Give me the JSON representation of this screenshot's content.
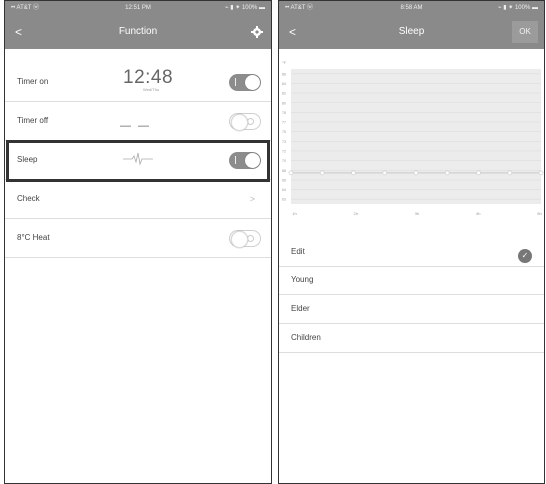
{
  "left_screen": {
    "statusbar": {
      "carrier": "•• AT&T ⓦ",
      "time": "12:51 PM",
      "battery": "⌁ ▮ ⁕ 100% ▬"
    },
    "navbar": {
      "back": "<",
      "title": "Function",
      "icon": "gear-icon"
    },
    "rows": [
      {
        "label": "Timer on",
        "time": "12:48",
        "date": "Wed/Thu",
        "toggle": "on"
      },
      {
        "label": "Timer off",
        "time": "— —",
        "toggle": "off"
      },
      {
        "label": "Sleep",
        "icon": "sleep-wave-icon",
        "toggle": "on",
        "selected": true
      },
      {
        "label": "Check",
        "chevron": ">"
      },
      {
        "label": "8°C Heat",
        "toggle": "off"
      }
    ]
  },
  "right_screen": {
    "statusbar": {
      "carrier": "•• AT&T ⓦ",
      "time": "8:58 AM",
      "battery": "⌁ ▮ ⁕ 100% ▬"
    },
    "navbar": {
      "back": "<",
      "title": "Sleep",
      "ok": "OK"
    },
    "chart_data": {
      "type": "line",
      "ylabel": "°F",
      "y_ticks": [
        "86",
        "84",
        "82",
        "80",
        "78",
        "77",
        "75",
        "73",
        "72",
        "70",
        "68",
        "66",
        "64",
        "63"
      ],
      "x_ticks": [
        "1h",
        "2h",
        "3h",
        "4h",
        "5h"
      ],
      "x": [
        0,
        1,
        2,
        3,
        4,
        5,
        6,
        7,
        8
      ],
      "values": [
        68,
        68,
        68,
        68,
        68,
        68,
        68,
        68,
        68
      ],
      "ylim": [
        62,
        88
      ],
      "grid": true,
      "colors": {
        "band": "#ececec",
        "line": "#c9c9c9",
        "point": "#d0d0d0"
      }
    },
    "options": [
      {
        "label": "Edit",
        "checked": true
      },
      {
        "label": "Young"
      },
      {
        "label": "Elder"
      },
      {
        "label": "Children"
      }
    ]
  }
}
